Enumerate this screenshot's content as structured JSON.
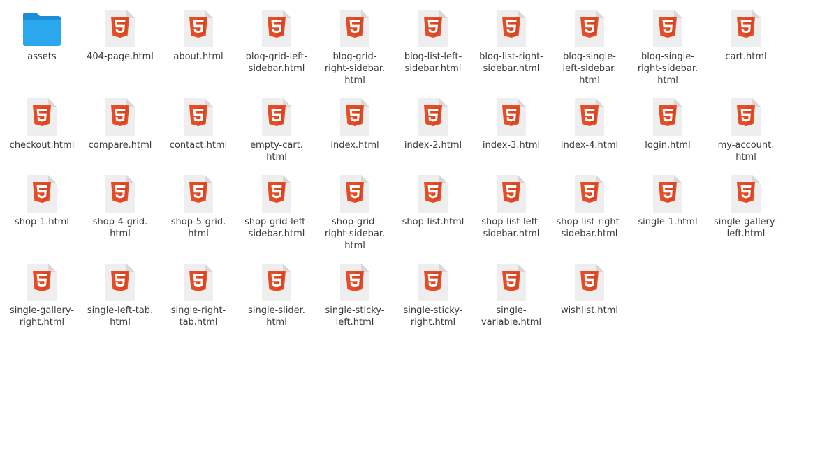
{
  "file_browser": {
    "colors": {
      "folder_back": "#1a8fd6",
      "folder_front": "#29a8ee",
      "html_badge": "#e44d26",
      "html_badge_dark": "#d03f1b",
      "page": "#eeeeee",
      "page_fold": "#d8d8d8",
      "label_text": "#3a3a3a"
    },
    "items": [
      {
        "type": "folder",
        "icon": "folder-icon",
        "label_lines": [
          "assets"
        ]
      },
      {
        "type": "html",
        "icon": "html5-file-icon",
        "label_lines": [
          "404-page.html"
        ]
      },
      {
        "type": "html",
        "icon": "html5-file-icon",
        "label_lines": [
          "about.html"
        ]
      },
      {
        "type": "html",
        "icon": "html5-file-icon",
        "label_lines": [
          "blog-grid-left-",
          "sidebar.html"
        ]
      },
      {
        "type": "html",
        "icon": "html5-file-icon",
        "label_lines": [
          "blog-grid-",
          "right-sidebar.",
          "html"
        ]
      },
      {
        "type": "html",
        "icon": "html5-file-icon",
        "label_lines": [
          "blog-list-left-",
          "sidebar.html"
        ]
      },
      {
        "type": "html",
        "icon": "html5-file-icon",
        "label_lines": [
          "blog-list-right-",
          "sidebar.html"
        ]
      },
      {
        "type": "html",
        "icon": "html5-file-icon",
        "label_lines": [
          "blog-single-",
          "left-sidebar.",
          "html"
        ]
      },
      {
        "type": "html",
        "icon": "html5-file-icon",
        "label_lines": [
          "blog-single-",
          "right-sidebar.",
          "html"
        ]
      },
      {
        "type": "html",
        "icon": "html5-file-icon",
        "label_lines": [
          "cart.html"
        ]
      },
      {
        "type": "html",
        "icon": "html5-file-icon",
        "label_lines": [
          "checkout.html"
        ]
      },
      {
        "type": "html",
        "icon": "html5-file-icon",
        "label_lines": [
          "compare.html"
        ]
      },
      {
        "type": "html",
        "icon": "html5-file-icon",
        "label_lines": [
          "contact.html"
        ]
      },
      {
        "type": "html",
        "icon": "html5-file-icon",
        "label_lines": [
          "empty-cart.",
          "html"
        ]
      },
      {
        "type": "html",
        "icon": "html5-file-icon",
        "label_lines": [
          "index.html"
        ]
      },
      {
        "type": "html",
        "icon": "html5-file-icon",
        "label_lines": [
          "index-2.html"
        ]
      },
      {
        "type": "html",
        "icon": "html5-file-icon",
        "label_lines": [
          "index-3.html"
        ]
      },
      {
        "type": "html",
        "icon": "html5-file-icon",
        "label_lines": [
          "index-4.html"
        ]
      },
      {
        "type": "html",
        "icon": "html5-file-icon",
        "label_lines": [
          "login.html"
        ]
      },
      {
        "type": "html",
        "icon": "html5-file-icon",
        "label_lines": [
          "my-account.",
          "html"
        ]
      },
      {
        "type": "html",
        "icon": "html5-file-icon",
        "label_lines": [
          "shop-1.html"
        ]
      },
      {
        "type": "html",
        "icon": "html5-file-icon",
        "label_lines": [
          "shop-4-grid.",
          "html"
        ]
      },
      {
        "type": "html",
        "icon": "html5-file-icon",
        "label_lines": [
          "shop-5-grid.",
          "html"
        ]
      },
      {
        "type": "html",
        "icon": "html5-file-icon",
        "label_lines": [
          "shop-grid-left-",
          "sidebar.html"
        ]
      },
      {
        "type": "html",
        "icon": "html5-file-icon",
        "label_lines": [
          "shop-grid-",
          "right-sidebar.",
          "html"
        ]
      },
      {
        "type": "html",
        "icon": "html5-file-icon",
        "label_lines": [
          "shop-list.html"
        ]
      },
      {
        "type": "html",
        "icon": "html5-file-icon",
        "label_lines": [
          "shop-list-left-",
          "sidebar.html"
        ]
      },
      {
        "type": "html",
        "icon": "html5-file-icon",
        "label_lines": [
          "shop-list-right-",
          "sidebar.html"
        ]
      },
      {
        "type": "html",
        "icon": "html5-file-icon",
        "label_lines": [
          "single-1.html"
        ]
      },
      {
        "type": "html",
        "icon": "html5-file-icon",
        "label_lines": [
          "single-gallery-",
          "left.html"
        ]
      },
      {
        "type": "html",
        "icon": "html5-file-icon",
        "label_lines": [
          "single-gallery-",
          "right.html"
        ]
      },
      {
        "type": "html",
        "icon": "html5-file-icon",
        "label_lines": [
          "single-left-tab.",
          "html"
        ]
      },
      {
        "type": "html",
        "icon": "html5-file-icon",
        "label_lines": [
          "single-right-",
          "tab.html"
        ]
      },
      {
        "type": "html",
        "icon": "html5-file-icon",
        "label_lines": [
          "single-slider.",
          "html"
        ]
      },
      {
        "type": "html",
        "icon": "html5-file-icon",
        "label_lines": [
          "single-sticky-",
          "left.html"
        ]
      },
      {
        "type": "html",
        "icon": "html5-file-icon",
        "label_lines": [
          "single-sticky-",
          "right.html"
        ]
      },
      {
        "type": "html",
        "icon": "html5-file-icon",
        "label_lines": [
          "single-",
          "variable.html"
        ]
      },
      {
        "type": "html",
        "icon": "html5-file-icon",
        "label_lines": [
          "wishlist.html"
        ]
      }
    ]
  }
}
